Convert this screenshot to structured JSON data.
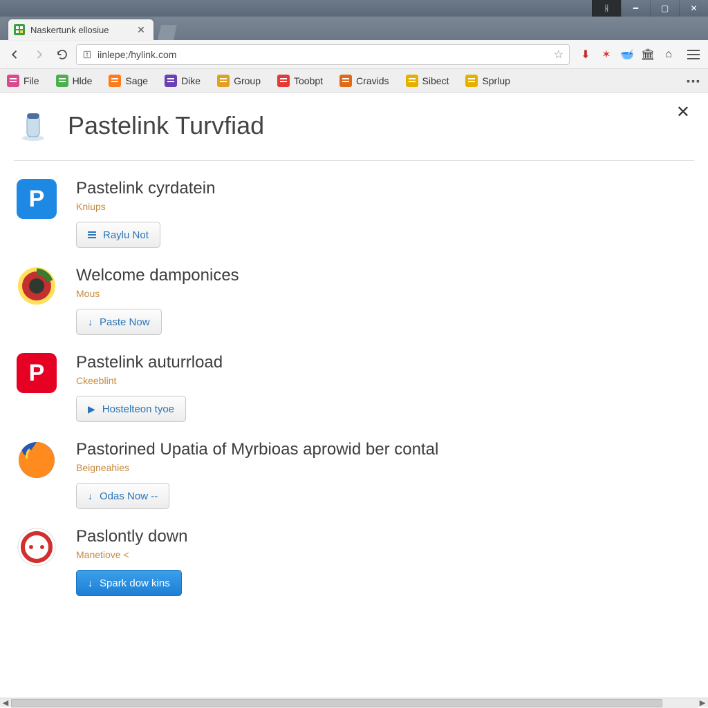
{
  "window": {
    "tab_title": "Naskertunk ellosiue"
  },
  "nav": {
    "url": "iinlepe;/hylink.com"
  },
  "extensions": [
    {
      "name": "download-red-icon",
      "glyph": "⬇",
      "color": "#c62828"
    },
    {
      "name": "star-red-icon",
      "glyph": "✶",
      "color": "#d32f2f"
    },
    {
      "name": "bowl-icon",
      "glyph": "🥣",
      "color": "#333"
    },
    {
      "name": "castle-icon",
      "glyph": "🏛",
      "color": "#333"
    },
    {
      "name": "home-icon",
      "glyph": "⌂",
      "color": "#333"
    }
  ],
  "bookmarks": [
    {
      "label": "File",
      "icon_color": "#d94b8e"
    },
    {
      "label": "Hlde",
      "icon_color": "#4caf50"
    },
    {
      "label": "Sage",
      "icon_color": "#ff7a1a"
    },
    {
      "label": "Dike",
      "icon_color": "#6b3fb5"
    },
    {
      "label": "Group",
      "icon_color": "#e0a020"
    },
    {
      "label": "Toobpt",
      "icon_color": "#e53935"
    },
    {
      "label": "Cravids",
      "icon_color": "#e06a18"
    },
    {
      "label": "Sibect",
      "icon_color": "#e6b000"
    },
    {
      "label": "Sprlup",
      "icon_color": "#e6b000"
    }
  ],
  "page": {
    "title": "Pastelink Turvfiad",
    "items": [
      {
        "title": "Pastelink cyrdatein",
        "sub": "Kniups",
        "button": "Raylu Not",
        "btn_style": "lines",
        "icon_letter": "P",
        "icon_bg": "#1e88e5",
        "icon_shape": "square"
      },
      {
        "title": "Welcome damponices",
        "sub": "Mous",
        "button": "Paste Now",
        "btn_style": "down",
        "icon_letter": "",
        "icon_bg": "radial",
        "icon_shape": "circle"
      },
      {
        "title": "Pastelink auturrload",
        "sub": "Ckeeblint",
        "button": "Hostelteon tyoe",
        "btn_style": "play",
        "icon_letter": "P",
        "icon_bg": "#e60023",
        "icon_shape": "square"
      },
      {
        "title": "Pastorined Upatia of Myrbioas aprowid ber contal",
        "sub": "Beigneahies",
        "button": "Odas Now --",
        "btn_style": "down",
        "icon_letter": "",
        "icon_bg": "firefox",
        "icon_shape": "circle"
      },
      {
        "title": "Paslontly down",
        "sub": "Manetiove <",
        "button": "Spark dow kins",
        "btn_style": "down-primary",
        "icon_letter": "⊙",
        "icon_bg": "#fff",
        "icon_shape": "circle-ring"
      }
    ]
  }
}
